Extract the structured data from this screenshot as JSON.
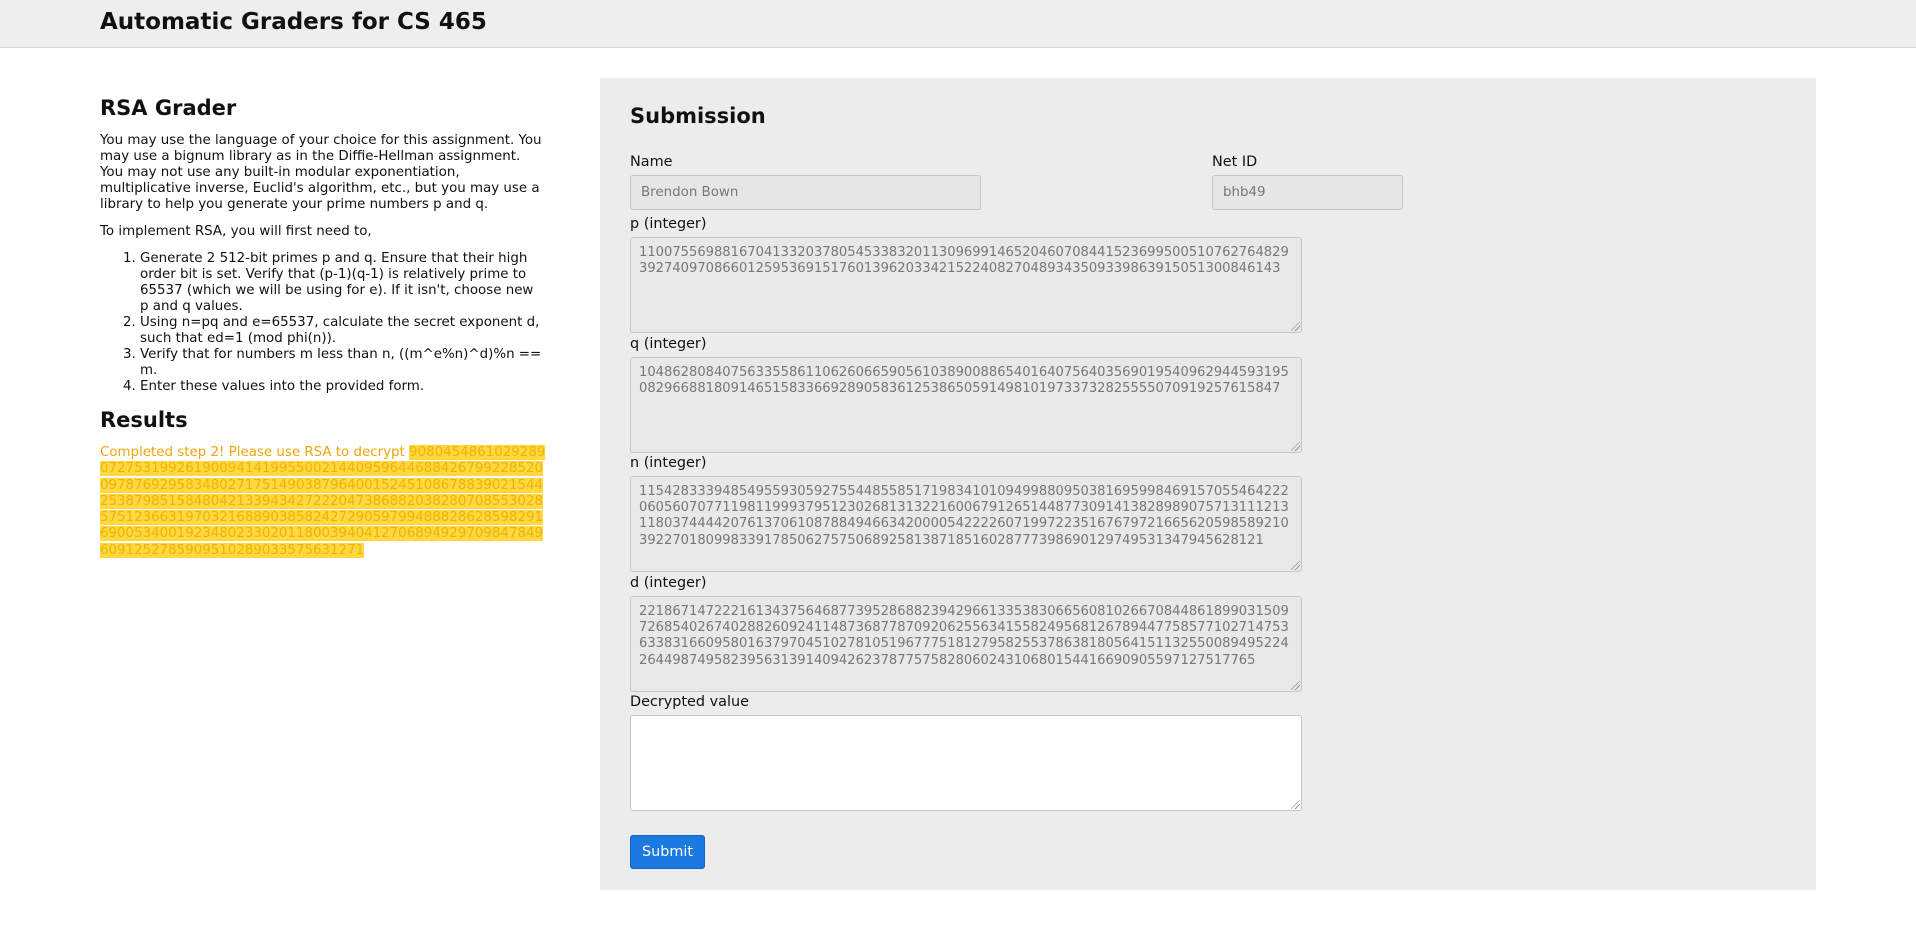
{
  "header": {
    "title": "Automatic Graders for CS 465"
  },
  "grader": {
    "title": "RSA Grader",
    "intro": "You may use the language of your choice for this assignment. You may use a bignum library as in the Diffie-Hellman assignment. You may not use any built-in modular exponentiation, multiplicative inverse, Euclid's algorithm, etc., but you may use a library to help you generate your prime numbers p and q.",
    "lead": "To implement RSA, you will first need to,",
    "steps": [
      "Generate 2 512-bit primes p and q. Ensure that their high order bit is set. Verify that (p-1)(q-1) is relatively prime to 65537 (which we will be using for e). If it isn't, choose new p and q values.",
      "Using n=pq and e=65537, calculate the secret exponent d, such that ed=1 (mod phi(n)).",
      "Verify that for numbers m less than n, ((m^e%n)^d)%n == m.",
      "Enter these values into the provided form."
    ]
  },
  "results": {
    "title": "Results",
    "message": "Completed step 2! Please use RSA to decrypt",
    "ciphertext": "90804548610292890727531992619009414199550021440959644688426799228520097876929583480271751490387964001524510867883902154425387985158480421339434272220473868820382807085530285751236631970321688903858242729059799488828628598291690053400192348023302011800394041270689492970984784960912527859095102890335756312​71"
  },
  "submission": {
    "title": "Submission",
    "name_label": "Name",
    "name_value": "Brendon Bown",
    "netid_label": "Net ID",
    "netid_value": "bhb49",
    "p_label": "p (integer)",
    "p_value": "1100755698816704133203780545338320113096991465204607084415236995005107627648293927409708660125953691517601396203342152240827048934350933986391505130084614​3",
    "q_label": "q (integer)",
    "q_value": "10486280840756335586110626066590561038900886540164075640356901954096294459319508296688180914651583366928905836125386505914981019733732825555070919257615847",
    "n_label": "n (integer)",
    "n_value": "11542833394854955930592755448558517198341010949988095038169599846915705546422206056070771198119993795123026813132216006791265144877309141382898907571311121311803744442076137061087884946634200005422226071997223516767972166562059858921039227018099833917850627575068925813871851602877739869012974953134794562812​1",
    "d_label": "d (integer)",
    "d_value": "22186714722216134375646877395286882394296613353830665608102667084486189903150972685402674028826092411487368778709206255634155824956812678944775857710271475363383166095801637970451027810519677751812795825537863818056415113255008949522426449874958239563139140942623787757582806024310680154416690905597127517765",
    "decrypted_label": "Decrypted value",
    "decrypted_value": "",
    "submit_label": "Submit"
  },
  "colors": {
    "accent": "#1b7ae0",
    "result_text": "#f0a40a",
    "result_highlight": "#ffd740",
    "panel_bg": "#ececec"
  }
}
